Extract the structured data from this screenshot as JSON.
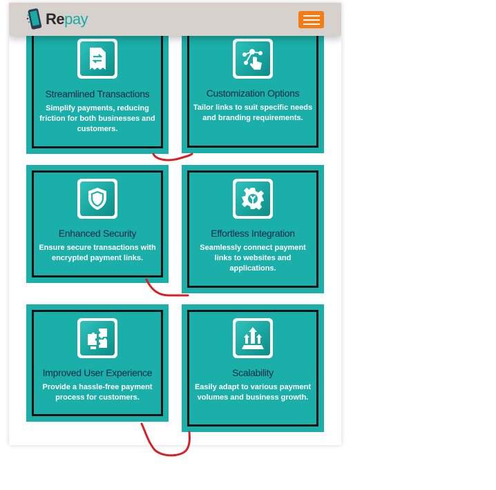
{
  "brand": {
    "logo_prefix": "Re",
    "logo_suffix": "pay"
  },
  "nav": {
    "menu_icon": "hamburger-menu-icon",
    "menu_color": "#f57c14"
  },
  "features": [
    {
      "title": "Streamlined Transactions",
      "desc": "Simplify payments, reducing friction for both businesses and customers.",
      "icon": "receipt-transfer-icon"
    },
    {
      "title": "Customization Options",
      "desc": "Tailor links to suit specific needs and branding requirements.",
      "icon": "touch-network-icon"
    },
    {
      "title": "Enhanced Security",
      "desc": "Ensure secure transactions with encrypted payment links.",
      "icon": "shield-icon"
    },
    {
      "title": "Effortless Integration",
      "desc": "Seamlessly connect payment links to websites and applications.",
      "icon": "gear-wrench-icon"
    },
    {
      "title": "Improved User Experience",
      "desc": "Provide a hassle-free payment process for customers.",
      "icon": "puzzle-icon"
    },
    {
      "title": "Scalability",
      "desc": "Easily adapt to various payment volumes and business growth.",
      "icon": "growth-arrows-icon"
    }
  ],
  "colors": {
    "card_bg": "#1aafa8",
    "card_border": "#111111",
    "title_color": "#0e2a4a",
    "annotation": "#d81f26"
  }
}
